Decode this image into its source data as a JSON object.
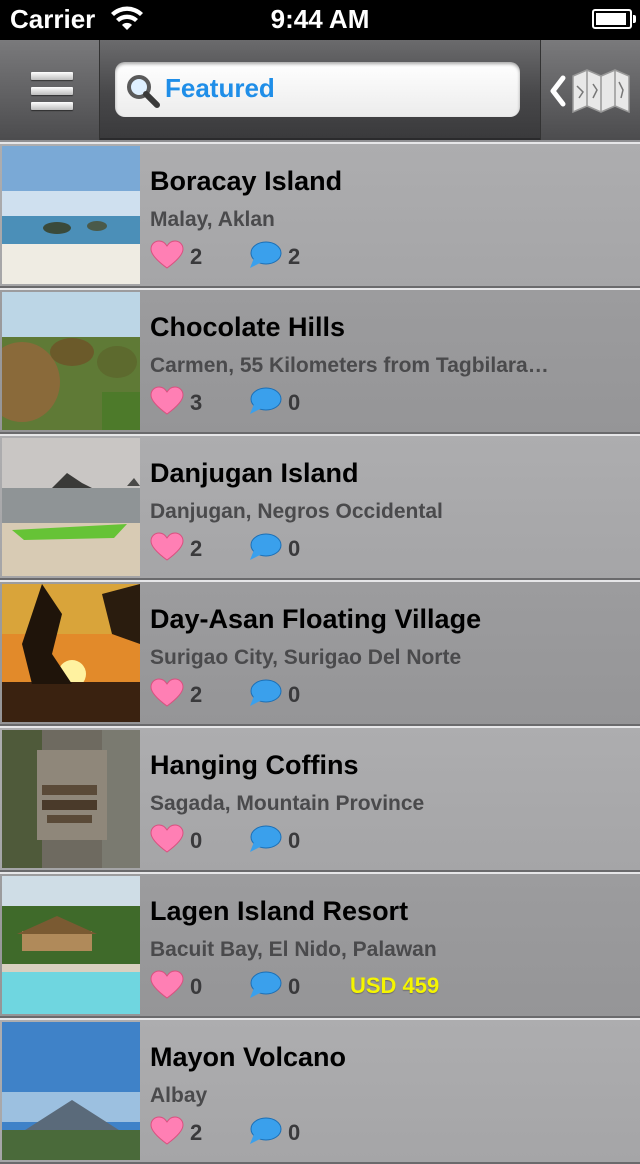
{
  "status_bar": {
    "carrier": "Carrier",
    "time": "9:44 AM"
  },
  "nav": {
    "search_label": "Featured"
  },
  "icons": {
    "menu": "menu-icon",
    "search": "search-icon",
    "map": "map-icon",
    "like": "heart-icon",
    "comment": "comment-bubble-icon"
  },
  "colors": {
    "search_text": "#1f8ee8",
    "price": "#f5f500",
    "heart": "#ff6ea8",
    "bubble": "#2a8fe0"
  },
  "places": [
    {
      "title": "Boracay Island",
      "location": "Malay, Aklan",
      "likes": "2",
      "comments": "2",
      "price": ""
    },
    {
      "title": "Chocolate Hills",
      "location": "Carmen, 55 Kilometers from Tagbilara…",
      "likes": "3",
      "comments": "0",
      "price": ""
    },
    {
      "title": "Danjugan Island",
      "location": "Danjugan, Negros Occidental",
      "likes": "2",
      "comments": "0",
      "price": ""
    },
    {
      "title": "Day-Asan Floating Village",
      "location": "Surigao City,  Surigao Del Norte",
      "likes": "2",
      "comments": "0",
      "price": ""
    },
    {
      "title": "Hanging Coffins",
      "location": "Sagada, Mountain Province",
      "likes": "0",
      "comments": "0",
      "price": ""
    },
    {
      "title": "Lagen Island Resort",
      "location": "Bacuit Bay, El Nido, Palawan",
      "likes": "0",
      "comments": "0",
      "price": "USD 459"
    },
    {
      "title": "Mayon Volcano",
      "location": "Albay",
      "likes": "2",
      "comments": "0",
      "price": ""
    }
  ]
}
